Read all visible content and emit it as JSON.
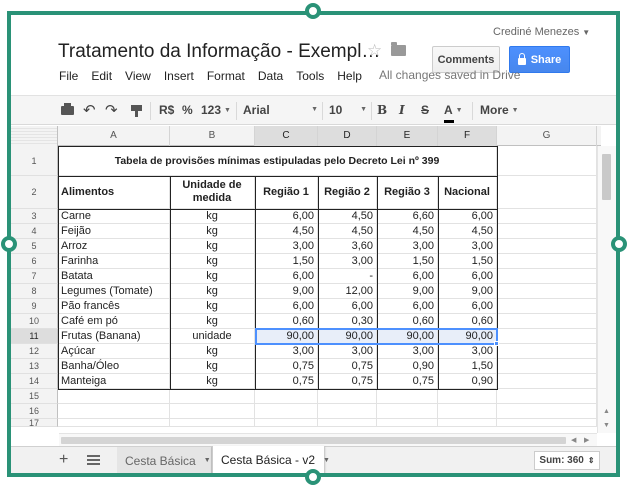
{
  "colors": {
    "frame": "#2a9277",
    "share": "#4d90fe",
    "selection": "#4d90fe",
    "highlight": "#e8eef9"
  },
  "header": {
    "title": "Tratamento da Informação - Exempl…",
    "user": "Crediné Menezes",
    "comments_label": "Comments",
    "share_label": "Share",
    "saved_status": "All changes saved in Drive",
    "star_icon": "star-icon",
    "folder_icon": "folder-icon"
  },
  "menu": [
    "File",
    "Edit",
    "View",
    "Insert",
    "Format",
    "Data",
    "Tools",
    "Help"
  ],
  "toolbar": {
    "currency": "R$",
    "percent": "%",
    "number_format": "123",
    "font": "Arial",
    "font_size": "10",
    "bold": "B",
    "italic": "I",
    "strike": "S",
    "text_color": "A",
    "more": "More"
  },
  "sheet": {
    "columns": [
      "A",
      "B",
      "C",
      "D",
      "E",
      "F",
      "G"
    ],
    "selected_columns": [
      "C",
      "D",
      "E",
      "F"
    ],
    "selected_row": "11",
    "row_numbers": [
      "1",
      "2",
      "3",
      "4",
      "5",
      "6",
      "7",
      "8",
      "9",
      "10",
      "11",
      "12",
      "13",
      "14",
      "15",
      "16",
      "17"
    ],
    "title": "Tabela de provisões mínimas estipuladas pelo Decreto Lei nº 399",
    "headers": [
      "Alimentos",
      "Unidade de medida",
      "Região 1",
      "Região 2",
      "Região 3",
      "Nacional"
    ],
    "rows": [
      [
        "Carne",
        "kg",
        "6,00",
        "4,50",
        "6,60",
        "6,00"
      ],
      [
        "Feijão",
        "kg",
        "4,50",
        "4,50",
        "4,50",
        "4,50"
      ],
      [
        "Arroz",
        "kg",
        "3,00",
        "3,60",
        "3,00",
        "3,00"
      ],
      [
        "Farinha",
        "kg",
        "1,50",
        "3,00",
        "1,50",
        "1,50"
      ],
      [
        "Batata",
        "kg",
        "6,00",
        "-",
        "6,00",
        "6,00"
      ],
      [
        "Legumes (Tomate)",
        "kg",
        "9,00",
        "12,00",
        "9,00",
        "9,00"
      ],
      [
        "Pão francês",
        "kg",
        "6,00",
        "6,00",
        "6,00",
        "6,00"
      ],
      [
        "Café em pó",
        "kg",
        "0,60",
        "0,30",
        "0,60",
        "0,60"
      ],
      [
        "Frutas (Banana)",
        "unidade",
        "90,00",
        "90,00",
        "90,00",
        "90,00"
      ],
      [
        "Açúcar",
        "kg",
        "3,00",
        "3,00",
        "3,00",
        "3,00"
      ],
      [
        "Banha/Óleo",
        "kg",
        "0,75",
        "0,75",
        "0,90",
        "1,50"
      ],
      [
        "Manteiga",
        "kg",
        "0,75",
        "0,75",
        "0,75",
        "0,90"
      ]
    ]
  },
  "tabs": [
    {
      "label": "Cesta Básica",
      "active": false
    },
    {
      "label": "Cesta Básica - v2",
      "active": true
    }
  ],
  "sum_label": "Sum: 360"
}
